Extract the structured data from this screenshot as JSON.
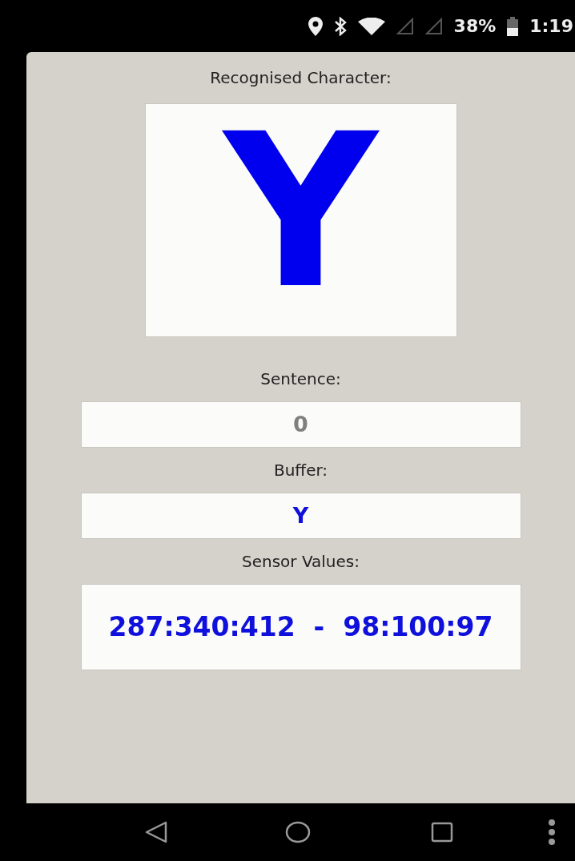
{
  "status_bar": {
    "battery_text": "38%",
    "time": "1:19"
  },
  "recognised": {
    "label": "Recognised Character:",
    "character": "Y"
  },
  "fields": [
    {
      "label": "Sentence:",
      "value": "0",
      "dimmed": true,
      "kind": "line"
    },
    {
      "label": "Buffer:",
      "value": "Y",
      "dimmed": false,
      "kind": "line"
    },
    {
      "label": "Sensor Values:",
      "value": "287:340:412  -  98:100:97",
      "dimmed": false,
      "kind": "tall"
    }
  ]
}
